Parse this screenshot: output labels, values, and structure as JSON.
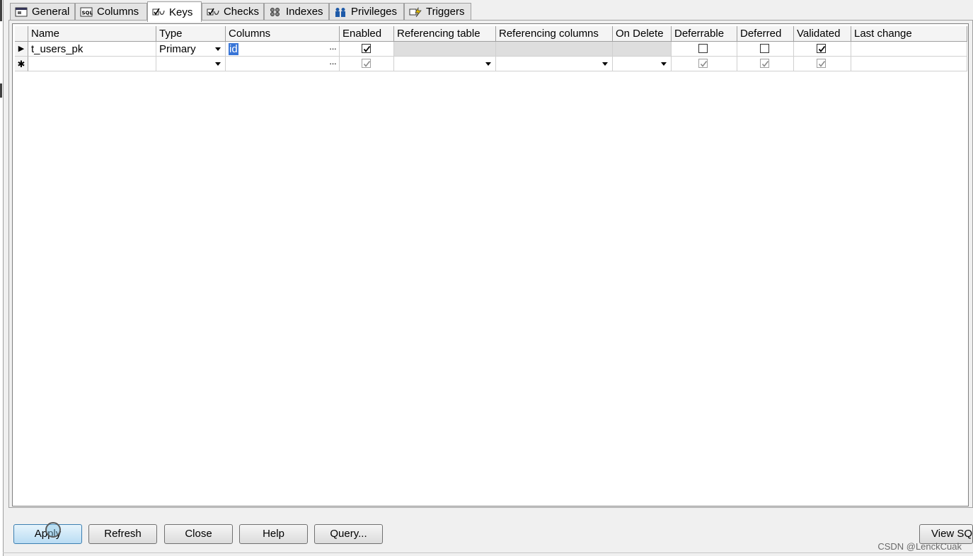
{
  "tabs": [
    {
      "label": "General",
      "icon": "general-icon"
    },
    {
      "label": "Columns",
      "icon": "columns-icon"
    },
    {
      "label": "Keys",
      "icon": "keys-icon",
      "active": true
    },
    {
      "label": "Checks",
      "icon": "checks-icon"
    },
    {
      "label": "Indexes",
      "icon": "indexes-icon"
    },
    {
      "label": "Privileges",
      "icon": "privileges-icon"
    },
    {
      "label": "Triggers",
      "icon": "triggers-icon"
    }
  ],
  "grid": {
    "columns": [
      "Name",
      "Type",
      "Columns",
      "Enabled",
      "Referencing table",
      "Referencing columns",
      "On Delete",
      "Deferrable",
      "Deferred",
      "Validated",
      "Last change"
    ],
    "rows": [
      {
        "name": "t_users_pk",
        "type": "Primary",
        "columns_value": "id",
        "enabled": true,
        "deferrable": false,
        "deferred": false,
        "validated": true,
        "last_change": ""
      },
      {
        "name": "",
        "type": "",
        "columns_value": "",
        "enabled": true,
        "deferrable": true,
        "deferred": true,
        "validated": true,
        "last_change": ""
      }
    ],
    "current_row_marker": "▶",
    "new_row_marker": "✱"
  },
  "buttons": {
    "apply": "Apply",
    "refresh": "Refresh",
    "close": "Close",
    "help": "Help",
    "query": "Query...",
    "view_sql": "View SQL"
  },
  "watermark": "CSDN @LenckCuak",
  "colors": {
    "selection": "#3875d7",
    "primary_button": "#b9dcf3"
  }
}
